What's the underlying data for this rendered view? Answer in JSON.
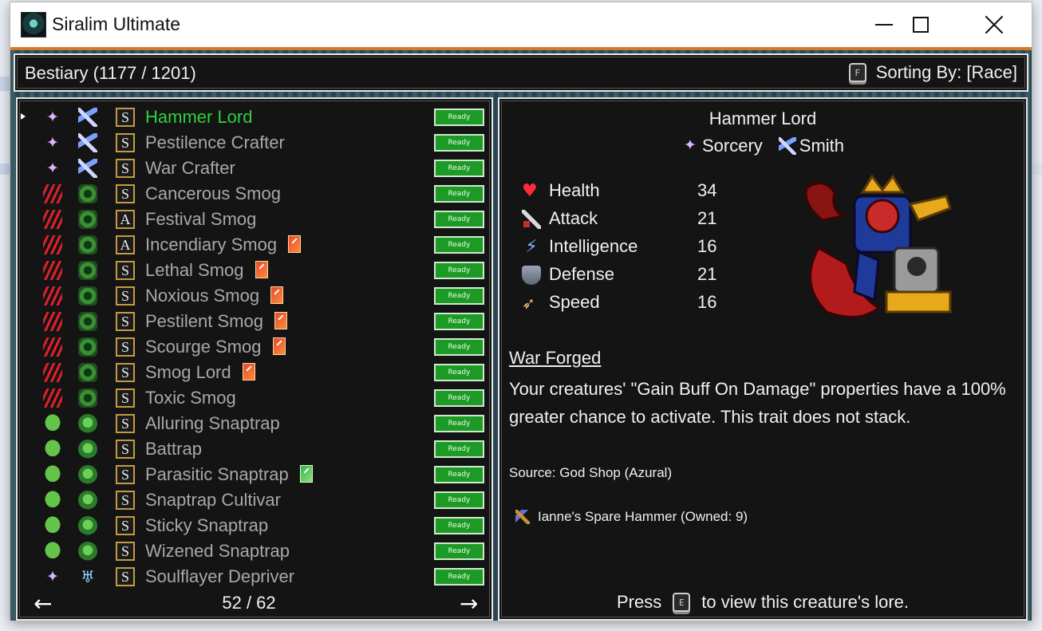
{
  "window": {
    "title": "Siralim Ultimate",
    "icons": [
      "app-icon",
      "minimize-icon",
      "maximize-icon",
      "close-icon"
    ]
  },
  "header": {
    "bestiary_label": "Bestiary (1177 / 1201)",
    "sort_key": "F",
    "sort_label": "Sorting By: [Race]"
  },
  "list": {
    "selected_index": 0,
    "rows": [
      {
        "name": "Hammer Lord",
        "class_icon": "sorcery",
        "race_icon": "smith",
        "type": "S",
        "card": "",
        "status": "Ready"
      },
      {
        "name": "Pestilence Crafter",
        "class_icon": "sorcery",
        "race_icon": "smith",
        "type": "S",
        "card": "",
        "status": "Ready"
      },
      {
        "name": "War Crafter",
        "class_icon": "sorcery",
        "race_icon": "smith",
        "type": "S",
        "card": "",
        "status": "Ready"
      },
      {
        "name": "Cancerous Smog",
        "class_icon": "chaos",
        "race_icon": "smog",
        "type": "S",
        "card": "",
        "status": "Ready"
      },
      {
        "name": "Festival Smog",
        "class_icon": "chaos",
        "race_icon": "smog",
        "type": "A",
        "card": "",
        "status": "Ready"
      },
      {
        "name": "Incendiary Smog",
        "class_icon": "chaos",
        "race_icon": "smog",
        "type": "A",
        "card": "red",
        "status": "Ready"
      },
      {
        "name": "Lethal Smog",
        "class_icon": "chaos",
        "race_icon": "smog",
        "type": "S",
        "card": "red",
        "status": "Ready"
      },
      {
        "name": "Noxious Smog",
        "class_icon": "chaos",
        "race_icon": "smog",
        "type": "S",
        "card": "red",
        "status": "Ready"
      },
      {
        "name": "Pestilent Smog",
        "class_icon": "chaos",
        "race_icon": "smog",
        "type": "S",
        "card": "red",
        "status": "Ready"
      },
      {
        "name": "Scourge Smog",
        "class_icon": "chaos",
        "race_icon": "smog",
        "type": "S",
        "card": "red",
        "status": "Ready"
      },
      {
        "name": "Smog Lord",
        "class_icon": "chaos",
        "race_icon": "smog",
        "type": "S",
        "card": "red",
        "status": "Ready"
      },
      {
        "name": "Toxic Smog",
        "class_icon": "chaos",
        "race_icon": "smog",
        "type": "S",
        "card": "",
        "status": "Ready"
      },
      {
        "name": "Alluring Snaptrap",
        "class_icon": "life",
        "race_icon": "snaptrap",
        "type": "S",
        "card": "",
        "status": "Ready"
      },
      {
        "name": "Battrap",
        "class_icon": "life",
        "race_icon": "snaptrap",
        "type": "S",
        "card": "",
        "status": "Ready"
      },
      {
        "name": "Parasitic Snaptrap",
        "class_icon": "life",
        "race_icon": "snaptrap",
        "type": "S",
        "card": "green",
        "status": "Ready"
      },
      {
        "name": "Snaptrap Cultivar",
        "class_icon": "life",
        "race_icon": "snaptrap",
        "type": "S",
        "card": "",
        "status": "Ready"
      },
      {
        "name": "Sticky Snaptrap",
        "class_icon": "life",
        "race_icon": "snaptrap",
        "type": "S",
        "card": "",
        "status": "Ready"
      },
      {
        "name": "Wizened Snaptrap",
        "class_icon": "life",
        "race_icon": "snaptrap",
        "type": "S",
        "card": "",
        "status": "Ready"
      },
      {
        "name": "Soulflayer Depriver",
        "class_icon": "sorcery",
        "race_icon": "soulflayer",
        "type": "S",
        "card": "",
        "status": "Ready"
      }
    ],
    "page": "52 / 62",
    "prev_arrow": "←",
    "next_arrow": "→"
  },
  "detail": {
    "name": "Hammer Lord",
    "class_name": "Sorcery",
    "race_name": "Smith",
    "stats": [
      {
        "label": "Health",
        "value": "34",
        "icon": "heart-icon"
      },
      {
        "label": "Attack",
        "value": "21",
        "icon": "sword-icon"
      },
      {
        "label": "Intelligence",
        "value": "16",
        "icon": "bolt-icon"
      },
      {
        "label": "Defense",
        "value": "21",
        "icon": "shield-icon"
      },
      {
        "label": "Speed",
        "value": "16",
        "icon": "wing-icon"
      }
    ],
    "trait_name": "War Forged",
    "trait_description": "Your creatures' \"Gain Buff On Damage\" properties have a 100% greater chance to activate. This trait does not stack.",
    "source": "Source: God Shop (Azural)",
    "item": "Ianne's Spare Hammer (Owned: 9)",
    "lore_prefix": "Press",
    "lore_key": "E",
    "lore_suffix": "to view this creature's lore."
  },
  "colors": {
    "selected": "#2ed13b",
    "ready_bg": "#1d9a25",
    "panel_bg": "#141414",
    "text": "#f0f0f0",
    "dim_text": "#a8a8a8"
  }
}
